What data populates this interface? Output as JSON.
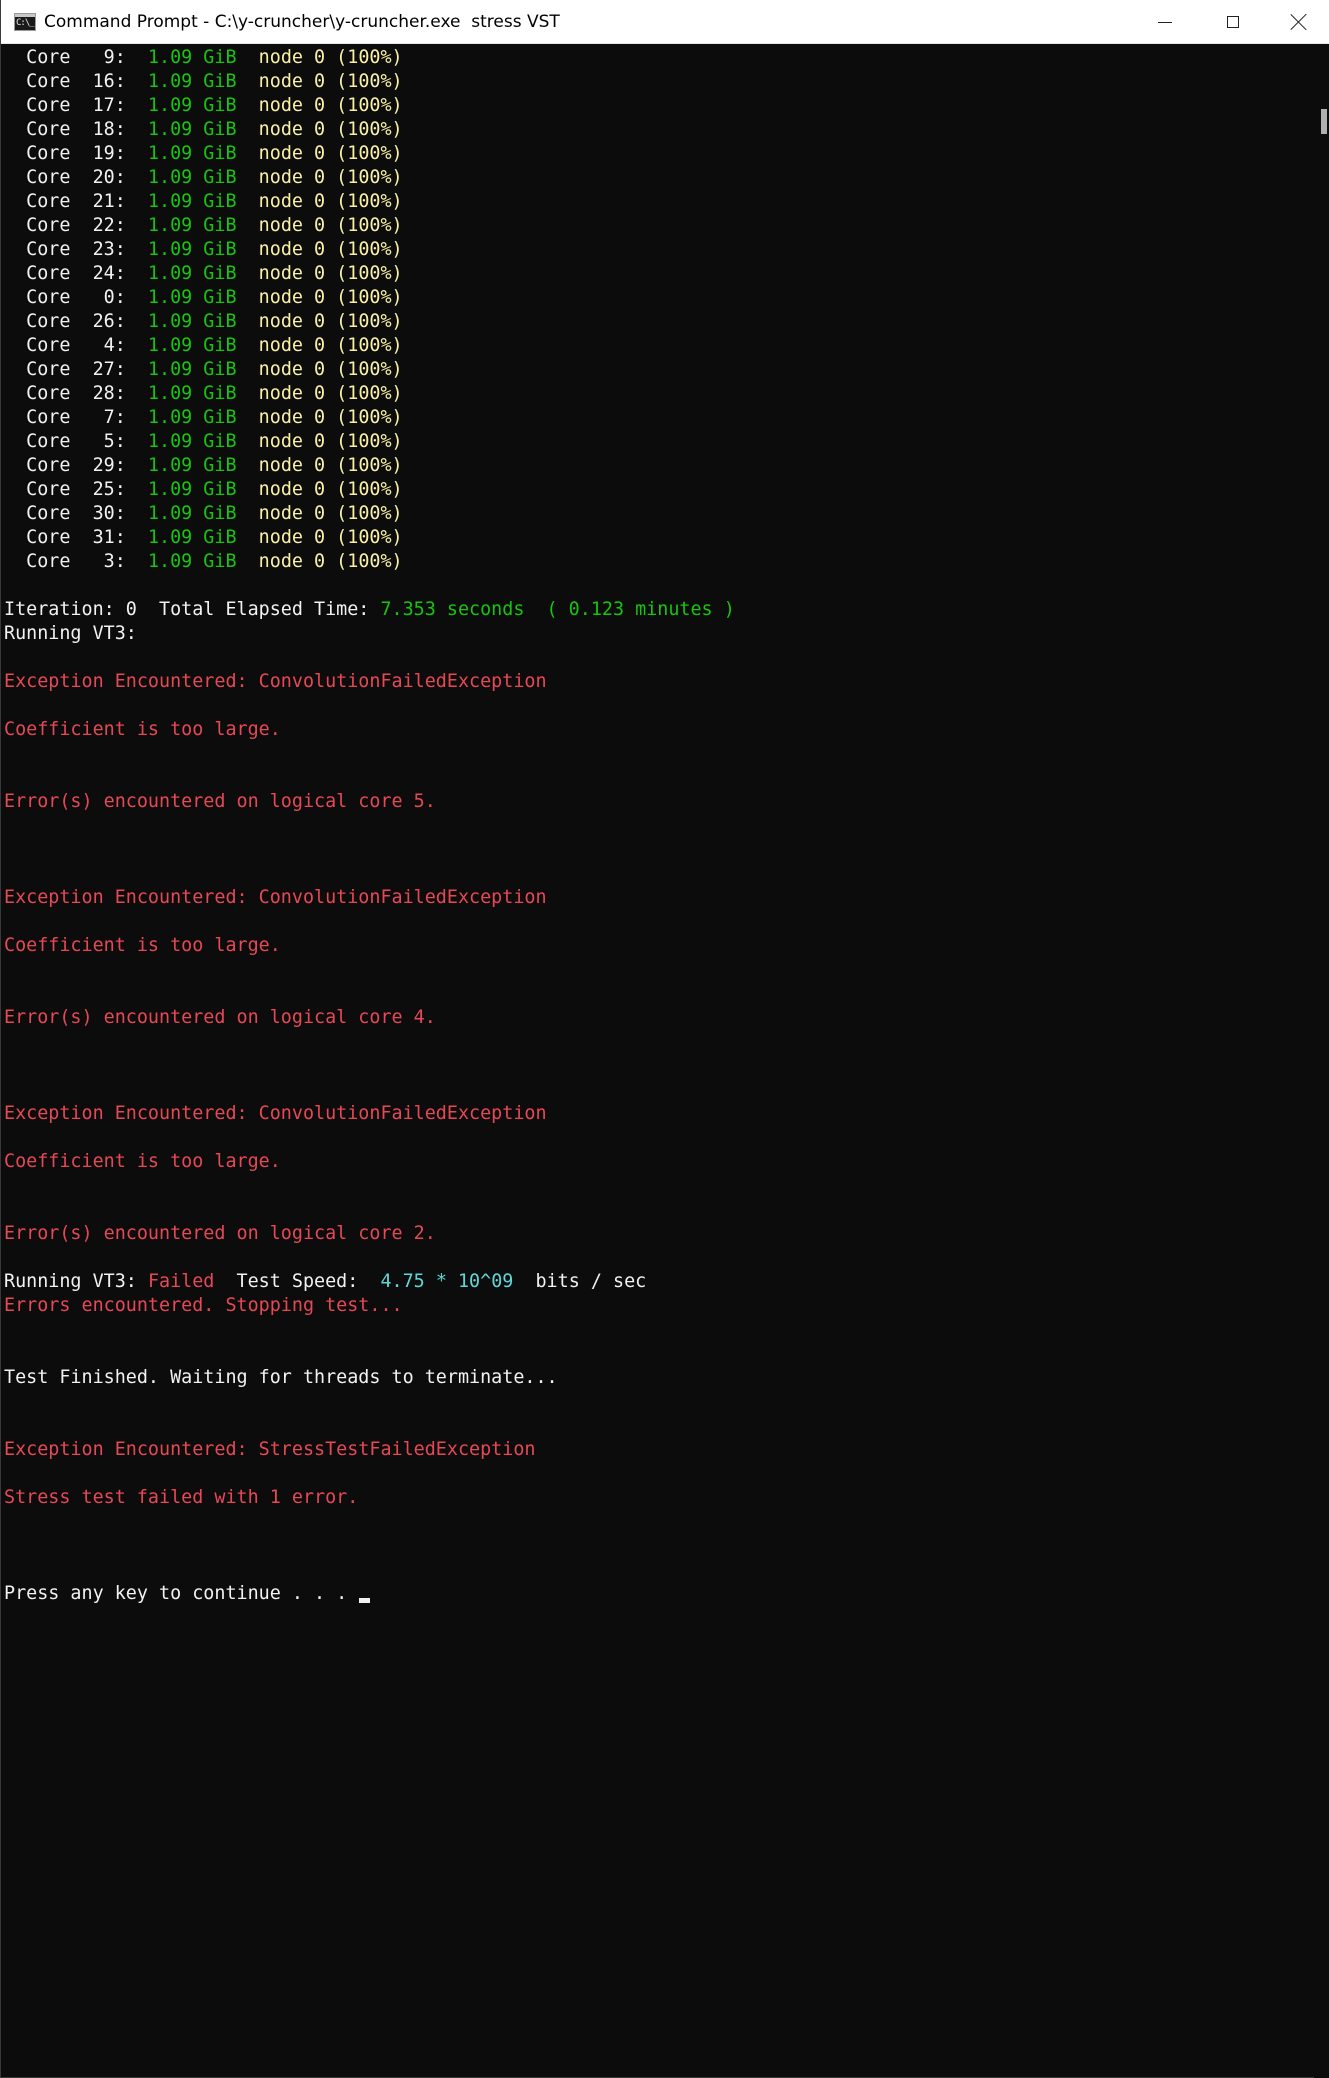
{
  "window": {
    "title": "Command Prompt - C:\\y-cruncher\\y-cruncher.exe  stress VST",
    "app_icon_glyph": "C:\\_"
  },
  "icons": {
    "app": "command-prompt-icon",
    "minimize": "minimize-icon",
    "maximize": "maximize-icon",
    "close": "close-icon"
  },
  "colors": {
    "background": "#0c0c0c",
    "default_text": "#cccccc",
    "bright_white": "#f2f2f2",
    "green": "#16c60c",
    "yellow": "#f9f1a5",
    "red": "#e74856",
    "cyan": "#61d6d6"
  },
  "core_rows": [
    {
      "label": "  Core   9:  ",
      "mem": "1.09 GiB",
      "node": "node 0 (100%)"
    },
    {
      "label": "  Core  16:  ",
      "mem": "1.09 GiB",
      "node": "node 0 (100%)"
    },
    {
      "label": "  Core  17:  ",
      "mem": "1.09 GiB",
      "node": "node 0 (100%)"
    },
    {
      "label": "  Core  18:  ",
      "mem": "1.09 GiB",
      "node": "node 0 (100%)"
    },
    {
      "label": "  Core  19:  ",
      "mem": "1.09 GiB",
      "node": "node 0 (100%)"
    },
    {
      "label": "  Core  20:  ",
      "mem": "1.09 GiB",
      "node": "node 0 (100%)"
    },
    {
      "label": "  Core  21:  ",
      "mem": "1.09 GiB",
      "node": "node 0 (100%)"
    },
    {
      "label": "  Core  22:  ",
      "mem": "1.09 GiB",
      "node": "node 0 (100%)"
    },
    {
      "label": "  Core  23:  ",
      "mem": "1.09 GiB",
      "node": "node 0 (100%)"
    },
    {
      "label": "  Core  24:  ",
      "mem": "1.09 GiB",
      "node": "node 0 (100%)"
    },
    {
      "label": "  Core   0:  ",
      "mem": "1.09 GiB",
      "node": "node 0 (100%)"
    },
    {
      "label": "  Core  26:  ",
      "mem": "1.09 GiB",
      "node": "node 0 (100%)"
    },
    {
      "label": "  Core   4:  ",
      "mem": "1.09 GiB",
      "node": "node 0 (100%)"
    },
    {
      "label": "  Core  27:  ",
      "mem": "1.09 GiB",
      "node": "node 0 (100%)"
    },
    {
      "label": "  Core  28:  ",
      "mem": "1.09 GiB",
      "node": "node 0 (100%)"
    },
    {
      "label": "  Core   7:  ",
      "mem": "1.09 GiB",
      "node": "node 0 (100%)"
    },
    {
      "label": "  Core   5:  ",
      "mem": "1.09 GiB",
      "node": "node 0 (100%)"
    },
    {
      "label": "  Core  29:  ",
      "mem": "1.09 GiB",
      "node": "node 0 (100%)"
    },
    {
      "label": "  Core  25:  ",
      "mem": "1.09 GiB",
      "node": "node 0 (100%)"
    },
    {
      "label": "  Core  30:  ",
      "mem": "1.09 GiB",
      "node": "node 0 (100%)"
    },
    {
      "label": "  Core  31:  ",
      "mem": "1.09 GiB",
      "node": "node 0 (100%)"
    },
    {
      "label": "  Core   3:  ",
      "mem": "1.09 GiB",
      "node": "node 0 (100%)"
    }
  ],
  "iteration": {
    "prefix": "Iteration: 0  Total Elapsed Time: ",
    "elapsed": "7.353 seconds  ( 0.123 minutes )"
  },
  "running_vt3": "Running VT3:",
  "errors": [
    {
      "exception": "Exception Encountered: ConvolutionFailedException",
      "message": "Coefficient is too large.",
      "core": "Error(s) encountered on logical core 5."
    },
    {
      "exception": "Exception Encountered: ConvolutionFailedException",
      "message": "Coefficient is too large.",
      "core": "Error(s) encountered on logical core 4."
    },
    {
      "exception": "Exception Encountered: ConvolutionFailedException",
      "message": "Coefficient is too large.",
      "core": "Error(s) encountered on logical core 2."
    }
  ],
  "result": {
    "prefix": "Running VT3: ",
    "status": "Failed",
    "speed_label": "  Test Speed:  ",
    "speed_value": "4.75 * 10^09",
    "speed_unit": "  bits / sec"
  },
  "errors_stopping": "Errors encountered. Stopping test...",
  "test_finished": "Test Finished. Waiting for threads to terminate...",
  "final_exception": "Exception Encountered: StressTestFailedException",
  "final_message": "Stress test failed with 1 error.",
  "prompt": "Press any key to continue . . . "
}
